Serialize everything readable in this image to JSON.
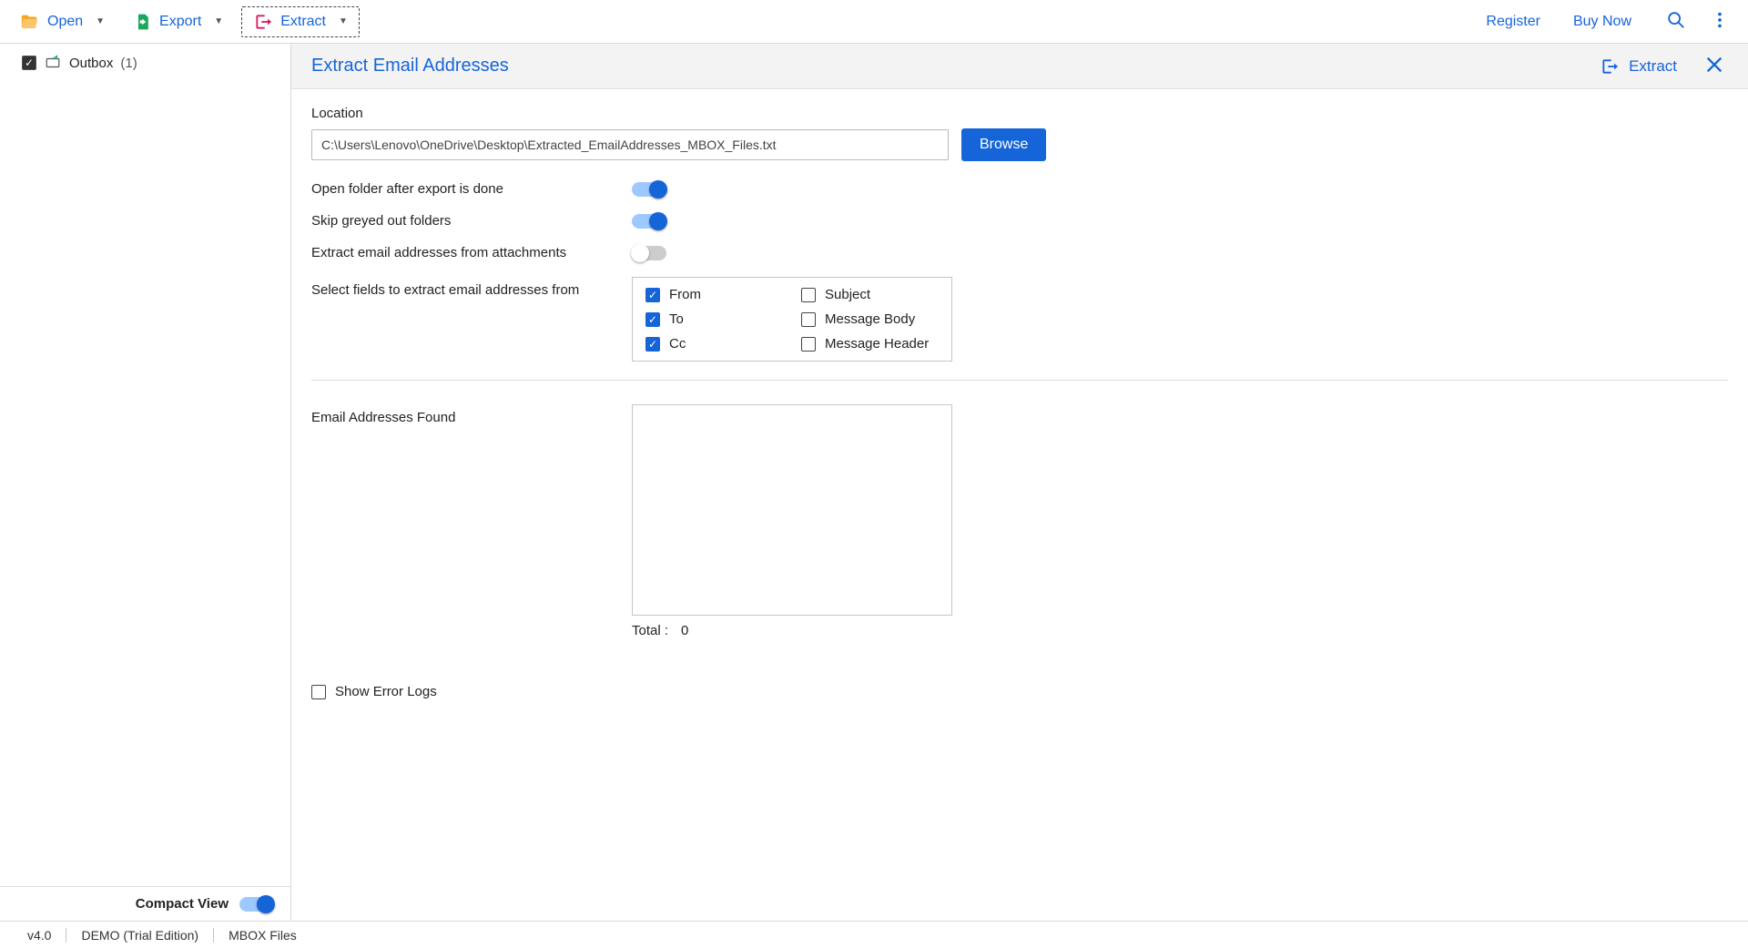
{
  "toolbar": {
    "open_label": "Open",
    "export_label": "Export",
    "extract_label": "Extract",
    "register_label": "Register",
    "buy_now_label": "Buy Now"
  },
  "sidebar": {
    "folder_name": "Outbox",
    "folder_count": "(1)",
    "folder_checked": true,
    "compact_view_label": "Compact View",
    "compact_view_on": true
  },
  "panel": {
    "title": "Extract Email Addresses",
    "extract_btn_label": "Extract",
    "location_label": "Location",
    "location_value": "C:\\Users\\Lenovo\\OneDrive\\Desktop\\Extracted_EmailAddresses_MBOX_Files.txt",
    "browse_label": "Browse",
    "opt_open_folder": "Open folder after export is done",
    "opt_open_folder_on": true,
    "opt_skip_greyed": "Skip greyed out folders",
    "opt_skip_greyed_on": true,
    "opt_from_attachments": "Extract email addresses from attachments",
    "opt_from_attachments_on": false,
    "select_fields_label": "Select fields to extract email addresses from",
    "fields": {
      "from_label": "From",
      "from_checked": true,
      "to_label": "To",
      "to_checked": true,
      "cc_label": "Cc",
      "cc_checked": true,
      "subject_label": "Subject",
      "subject_checked": false,
      "body_label": "Message Body",
      "body_checked": false,
      "header_label": "Message Header",
      "header_checked": false
    },
    "found_label": "Email Addresses Found",
    "total_label": "Total :",
    "total_value": "0",
    "show_error_logs_label": "Show Error Logs",
    "show_error_logs_checked": false
  },
  "status": {
    "version": "v4.0",
    "edition": "DEMO (Trial Edition)",
    "filetype": "MBOX Files"
  }
}
